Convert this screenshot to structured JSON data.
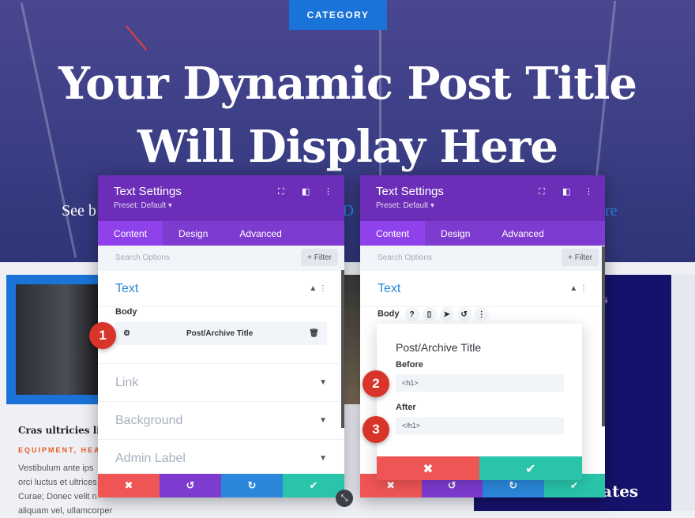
{
  "hero": {
    "category": "CATEGORY",
    "title_line1": "Your Dynamic Post Title",
    "title_line2": "Will Display Here",
    "sub_left": "See b",
    "sub_mid": "r D",
    "sub_right": "re"
  },
  "card": {
    "title": "Cras ultricies ligu",
    "categories": "EQUIPMENT, HEAL",
    "body": [
      "Vestibulum ante ips",
      "orci luctus et ultrices",
      "Curae; Donec velit n",
      "aliquam vel, ullamcorper"
    ]
  },
  "right_block": {
    "frag1": "s",
    "frag2": "ates"
  },
  "colors": {
    "header": "#6c2eb9",
    "tabs": "#7e3bd0",
    "cancel": "#ef5555",
    "undo": "#7d3bcf",
    "redo": "#2b87da",
    "save": "#29c4a9",
    "badge": "#d8342a"
  },
  "panel1": {
    "title": "Text Settings",
    "preset": "Preset: Default ▾",
    "tabs": [
      "Content",
      "Design",
      "Advanced"
    ],
    "search_placeholder": "Search Options",
    "filter": "+ Filter",
    "section": "Text",
    "body_label": "Body",
    "dynamic_value": "Post/Archive Title",
    "sections": [
      "Link",
      "Background",
      "Admin Label"
    ]
  },
  "panel2": {
    "title": "Text Settings",
    "preset": "Preset: Default ▾",
    "tabs": [
      "Content",
      "Design",
      "Advanced"
    ],
    "search_placeholder": "Search Options",
    "filter": "+ Filter",
    "section": "Text",
    "body_label": "Body"
  },
  "popup": {
    "title": "Post/Archive Title",
    "before_label": "Before",
    "before_value": "<h1>",
    "after_label": "After",
    "after_value": "</h1>"
  },
  "badges": [
    "1",
    "2",
    "3"
  ]
}
